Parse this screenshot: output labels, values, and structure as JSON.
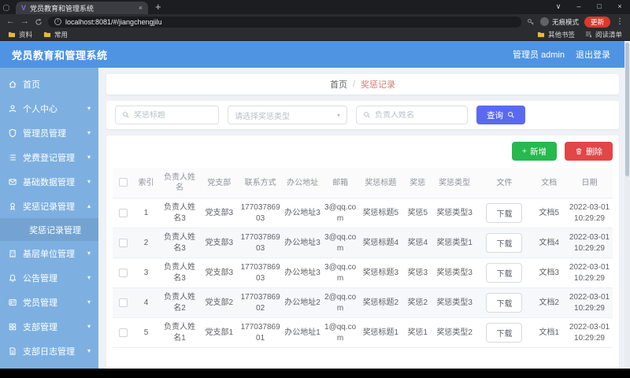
{
  "browser": {
    "favicon_letter": "V",
    "tab_title": "党员教育和管理系统",
    "url": "localhost:8081/#/jiangchengjilu",
    "bookmarks": [
      "资料",
      "常用"
    ],
    "other_bookmarks": "其他书签",
    "reading_list": "阅读清单",
    "incognito_label": "无痕模式",
    "update_label": "更新"
  },
  "header": {
    "title": "党员教育和管理系统",
    "user": "管理员 admin",
    "logout": "退出登录"
  },
  "sidebar": {
    "items": [
      {
        "label": "首页",
        "icon": "home-icon",
        "chevron": false
      },
      {
        "label": "个人中心",
        "icon": "user-icon",
        "chevron": true
      },
      {
        "label": "管理员管理",
        "icon": "admin-icon",
        "chevron": true
      },
      {
        "label": "党费登记管理",
        "icon": "fee-icon",
        "chevron": true
      },
      {
        "label": "基础数据管理",
        "icon": "data-icon",
        "chevron": true
      },
      {
        "label": "奖惩记录管理",
        "icon": "record-icon",
        "chevron": true,
        "expanded": true,
        "children": [
          {
            "label": "奖惩记录管理",
            "active": true
          }
        ]
      },
      {
        "label": "基层单位管理",
        "icon": "unit-icon",
        "chevron": true
      },
      {
        "label": "公告管理",
        "icon": "announce-icon",
        "chevron": true
      },
      {
        "label": "党员管理",
        "icon": "member-icon",
        "chevron": true
      },
      {
        "label": "支部管理",
        "icon": "branch-icon",
        "chevron": true
      },
      {
        "label": "支部日志管理",
        "icon": "log-icon",
        "chevron": true
      }
    ]
  },
  "breadcrumb": {
    "home": "首页",
    "separator": "/",
    "current": "奖惩记录"
  },
  "search": {
    "title_placeholder": "奖惩标题",
    "type_placeholder": "请选择奖惩类型",
    "name_placeholder": "负责人姓名",
    "query_label": "查询"
  },
  "actions": {
    "add_label": "新增",
    "delete_label": "删除"
  },
  "table": {
    "headers": [
      "索引",
      "负责人姓名",
      "党支部",
      "联系方式",
      "办公地址",
      "邮箱",
      "奖惩标题",
      "奖惩",
      "奖惩类型",
      "文件",
      "文档",
      "日期"
    ],
    "download_label": "下载",
    "rows": [
      {
        "index": "1",
        "name": "负责人姓名3",
        "branch": "党支部3",
        "phone": "17703786903",
        "address": "办公地址3",
        "email": "3@qq.com",
        "title": "奖惩标题5",
        "award": "奖惩5",
        "type": "奖惩类型3",
        "doc": "文档5",
        "date": "2022-03-01 10:29:29"
      },
      {
        "index": "2",
        "name": "负责人姓名3",
        "branch": "党支部3",
        "phone": "17703786903",
        "address": "办公地址3",
        "email": "3@qq.com",
        "title": "奖惩标题4",
        "award": "奖惩4",
        "type": "奖惩类型1",
        "doc": "文档4",
        "date": "2022-03-01 10:29:29"
      },
      {
        "index": "3",
        "name": "负责人姓名3",
        "branch": "党支部3",
        "phone": "17703786903",
        "address": "办公地址3",
        "email": "3@qq.com",
        "title": "奖惩标题3",
        "award": "奖惩3",
        "type": "奖惩类型3",
        "doc": "文档3",
        "date": "2022-03-01 10:29:29"
      },
      {
        "index": "4",
        "name": "负责人姓名2",
        "branch": "党支部2",
        "phone": "17703786902",
        "address": "办公地址2",
        "email": "2@qq.com",
        "title": "奖惩标题2",
        "award": "奖惩2",
        "type": "奖惩类型3",
        "doc": "文档2",
        "date": "2022-03-01 10:29:29"
      },
      {
        "index": "5",
        "name": "负责人姓名1",
        "branch": "党支部1",
        "phone": "17703786901",
        "address": "办公地址1",
        "email": "1@qq.com",
        "title": "奖惩标题1",
        "award": "奖惩1",
        "type": "奖惩类型2",
        "doc": "文档1",
        "date": "2022-03-01 10:29:29"
      }
    ]
  },
  "colors": {
    "header_blue": "#4f94e3",
    "sidebar_blue": "#7db0e1",
    "primary": "#5a6af0",
    "success": "#27b84e",
    "danger": "#e14747",
    "breadcrumb_current": "#d27b76",
    "update_red": "#d93a2b"
  }
}
